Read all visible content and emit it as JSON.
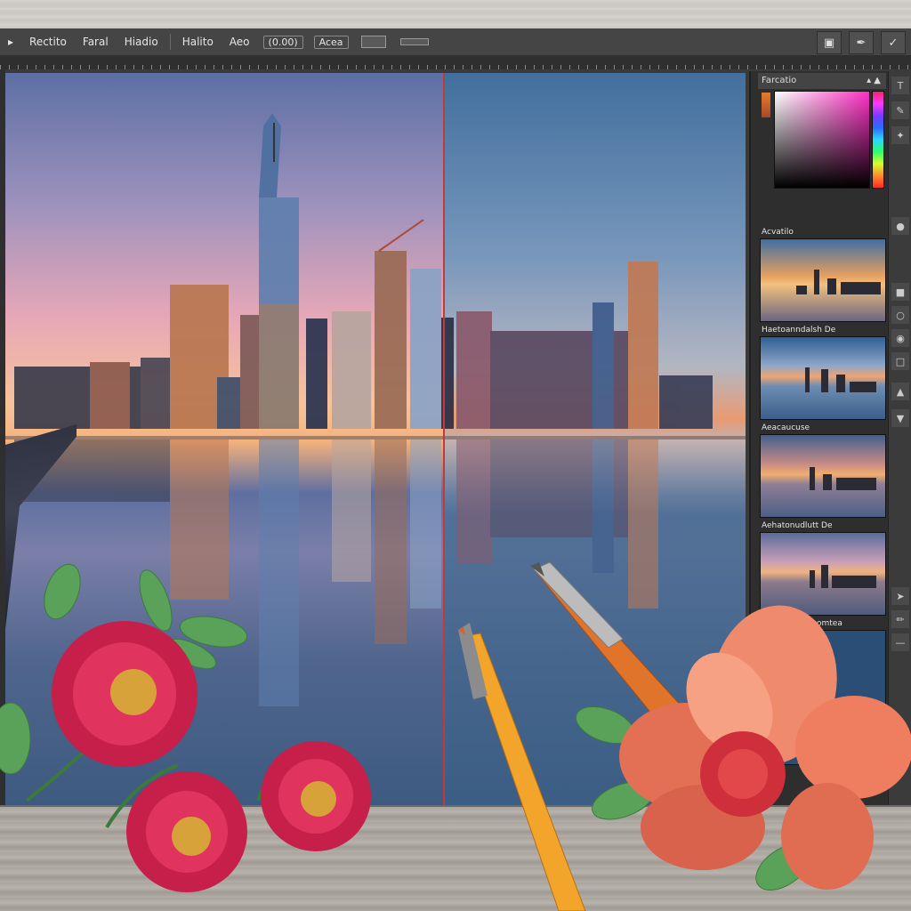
{
  "menubar": {
    "items": [
      "Rectito",
      "Faral",
      "Hiadio",
      "Halito",
      "Aeo",
      "(0.00)",
      "Acea"
    ]
  },
  "toolbar_right": {
    "icons": [
      "window-icon",
      "pen-icon",
      "brush-icon"
    ]
  },
  "panel": {
    "tab_title": "Farcatio",
    "tab_icons": "▴ ▲",
    "layers": [
      {
        "label": "Acvatilo"
      },
      {
        "label": "Haetoanndalsh De"
      },
      {
        "label": "Aeacaucuse"
      },
      {
        "label": "Aehatonudlutt De"
      },
      {
        "label": "Aeavanta Casomtea"
      }
    ]
  },
  "colors": {
    "panel_bg": "#2e2e2e",
    "picker_hue": "#ff2fc4",
    "split_line": "#c23a3a"
  }
}
